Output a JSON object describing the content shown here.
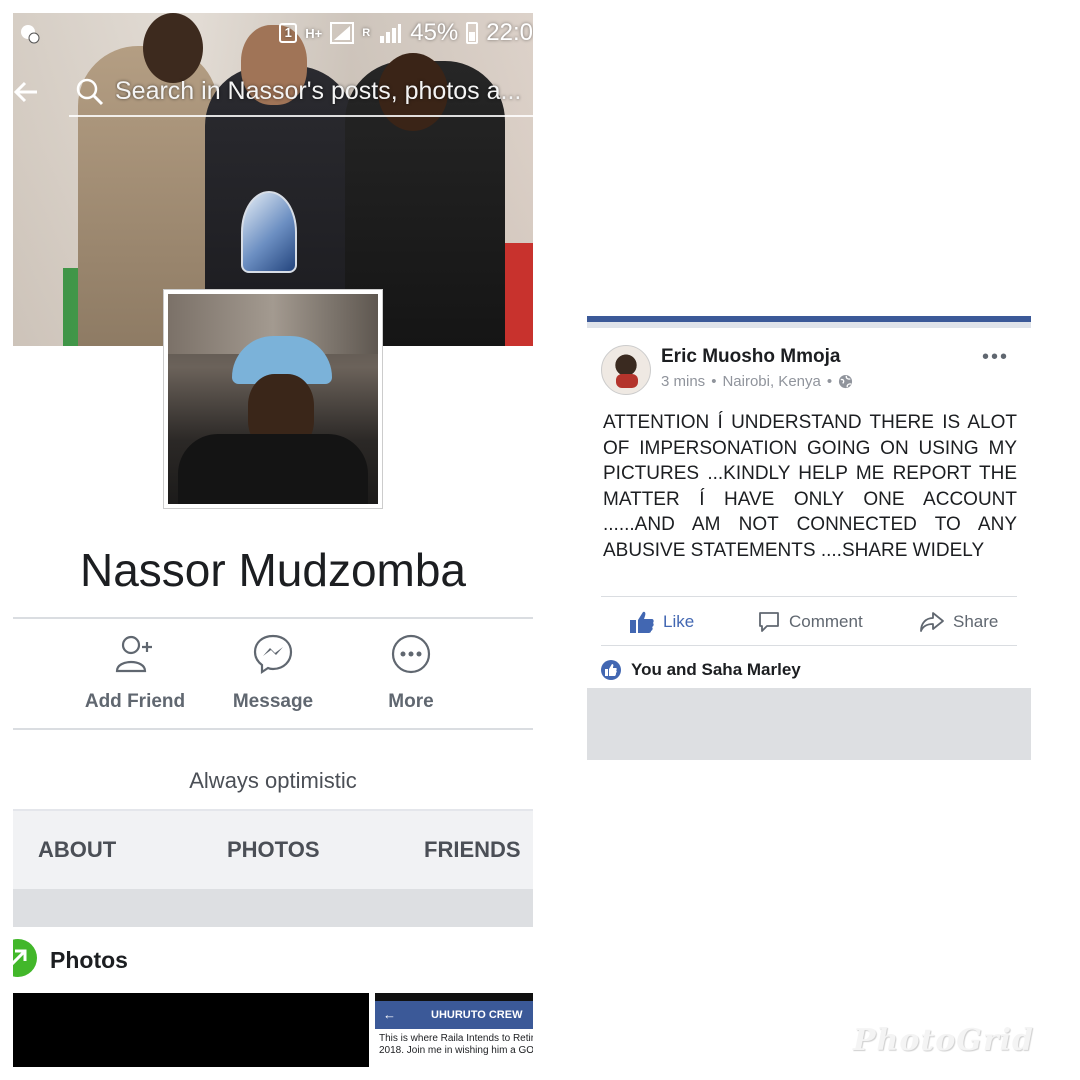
{
  "left_panel": {
    "status_bar": {
      "sim_badge": "1",
      "network": "H+",
      "roaming": "R",
      "battery_percent": "45%",
      "time": "22:0"
    },
    "search": {
      "placeholder": "Search in Nassor's posts, photos a..."
    },
    "profile": {
      "name": "Nassor Mudzomba",
      "tagline": "Always optimistic"
    },
    "actions": [
      {
        "label": "Add Friend",
        "icon": "add-friend-icon"
      },
      {
        "label": "Message",
        "icon": "messenger-icon"
      },
      {
        "label": "More",
        "icon": "more-dots-icon"
      }
    ],
    "tabs": [
      "ABOUT",
      "PHOTOS",
      "FRIENDS"
    ],
    "photos_section": {
      "title": "Photos",
      "thumb2_header": "UHURUTO CREW",
      "thumb2_lines": [
        "This is where Raila Intends to Retir",
        "2018. Join me in wishing him a GO"
      ]
    }
  },
  "post": {
    "author": "Eric Muosho Mmoja",
    "time": "3 mins",
    "location": "Nairobi, Kenya",
    "separator": "•",
    "menu": "•••",
    "body": "ATTENTION Í UNDERSTAND THERE IS ALOT OF IMPERSONATION GOING ON USING MY PICTURES ...KINDLY HELP ME REPORT THE MATTER Í HAVE ONLY ONE ACCOUNT ......AND AM NOT CONNECTED TO ANY ABUSIVE STATEMENTS ....SHARE WIDELY",
    "buttons": {
      "like": "Like",
      "comment": "Comment",
      "share": "Share"
    },
    "likes_text": "You and Saha Marley"
  },
  "watermark": "PhotoGrid",
  "colors": {
    "facebook_blue": "#4267b2",
    "header_blue": "#3b5998",
    "photos_green": "#42b72a"
  }
}
